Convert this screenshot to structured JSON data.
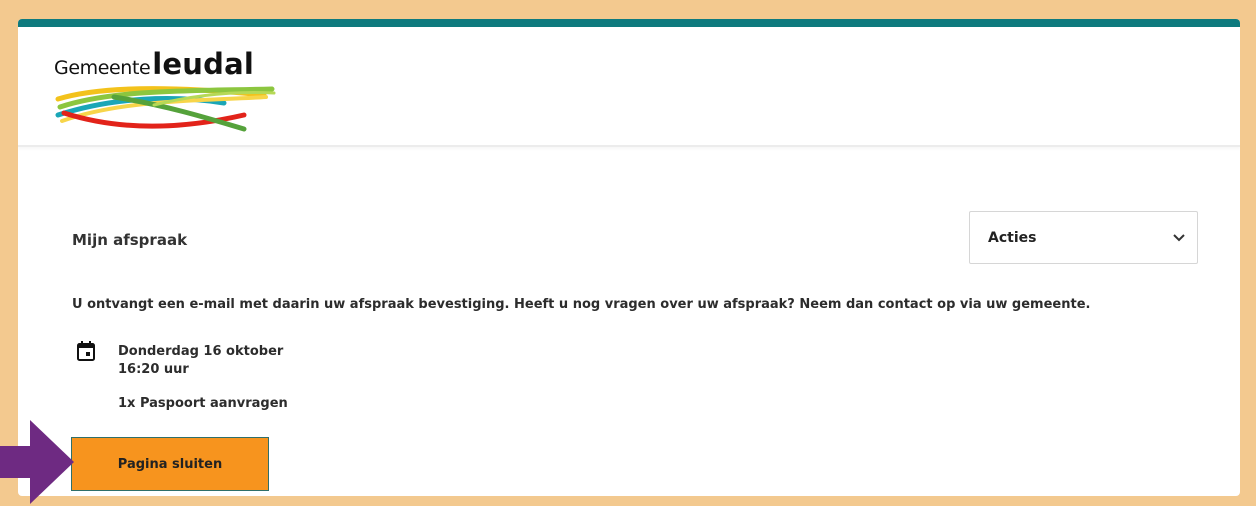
{
  "header": {
    "logo_prefix": "Gemeente",
    "logo_name": "leudal"
  },
  "appointment": {
    "title": "Mijn afspraak",
    "actions_label": "Acties",
    "info": "U ontvangt een e-mail met daarin uw afspraak bevestiging. Heeft u nog vragen over uw afspraak? Neem dan contact op via uw gemeente.",
    "date": "Donderdag 16 oktober",
    "time": "16:20 uur",
    "service": "1x Paspoort aanvragen",
    "close_label": "Pagina sluiten"
  },
  "colors": {
    "background": "#f3c98f",
    "top_bar": "#0e7a7e",
    "button": "#f7941e",
    "arrow": "#6e2a82"
  }
}
